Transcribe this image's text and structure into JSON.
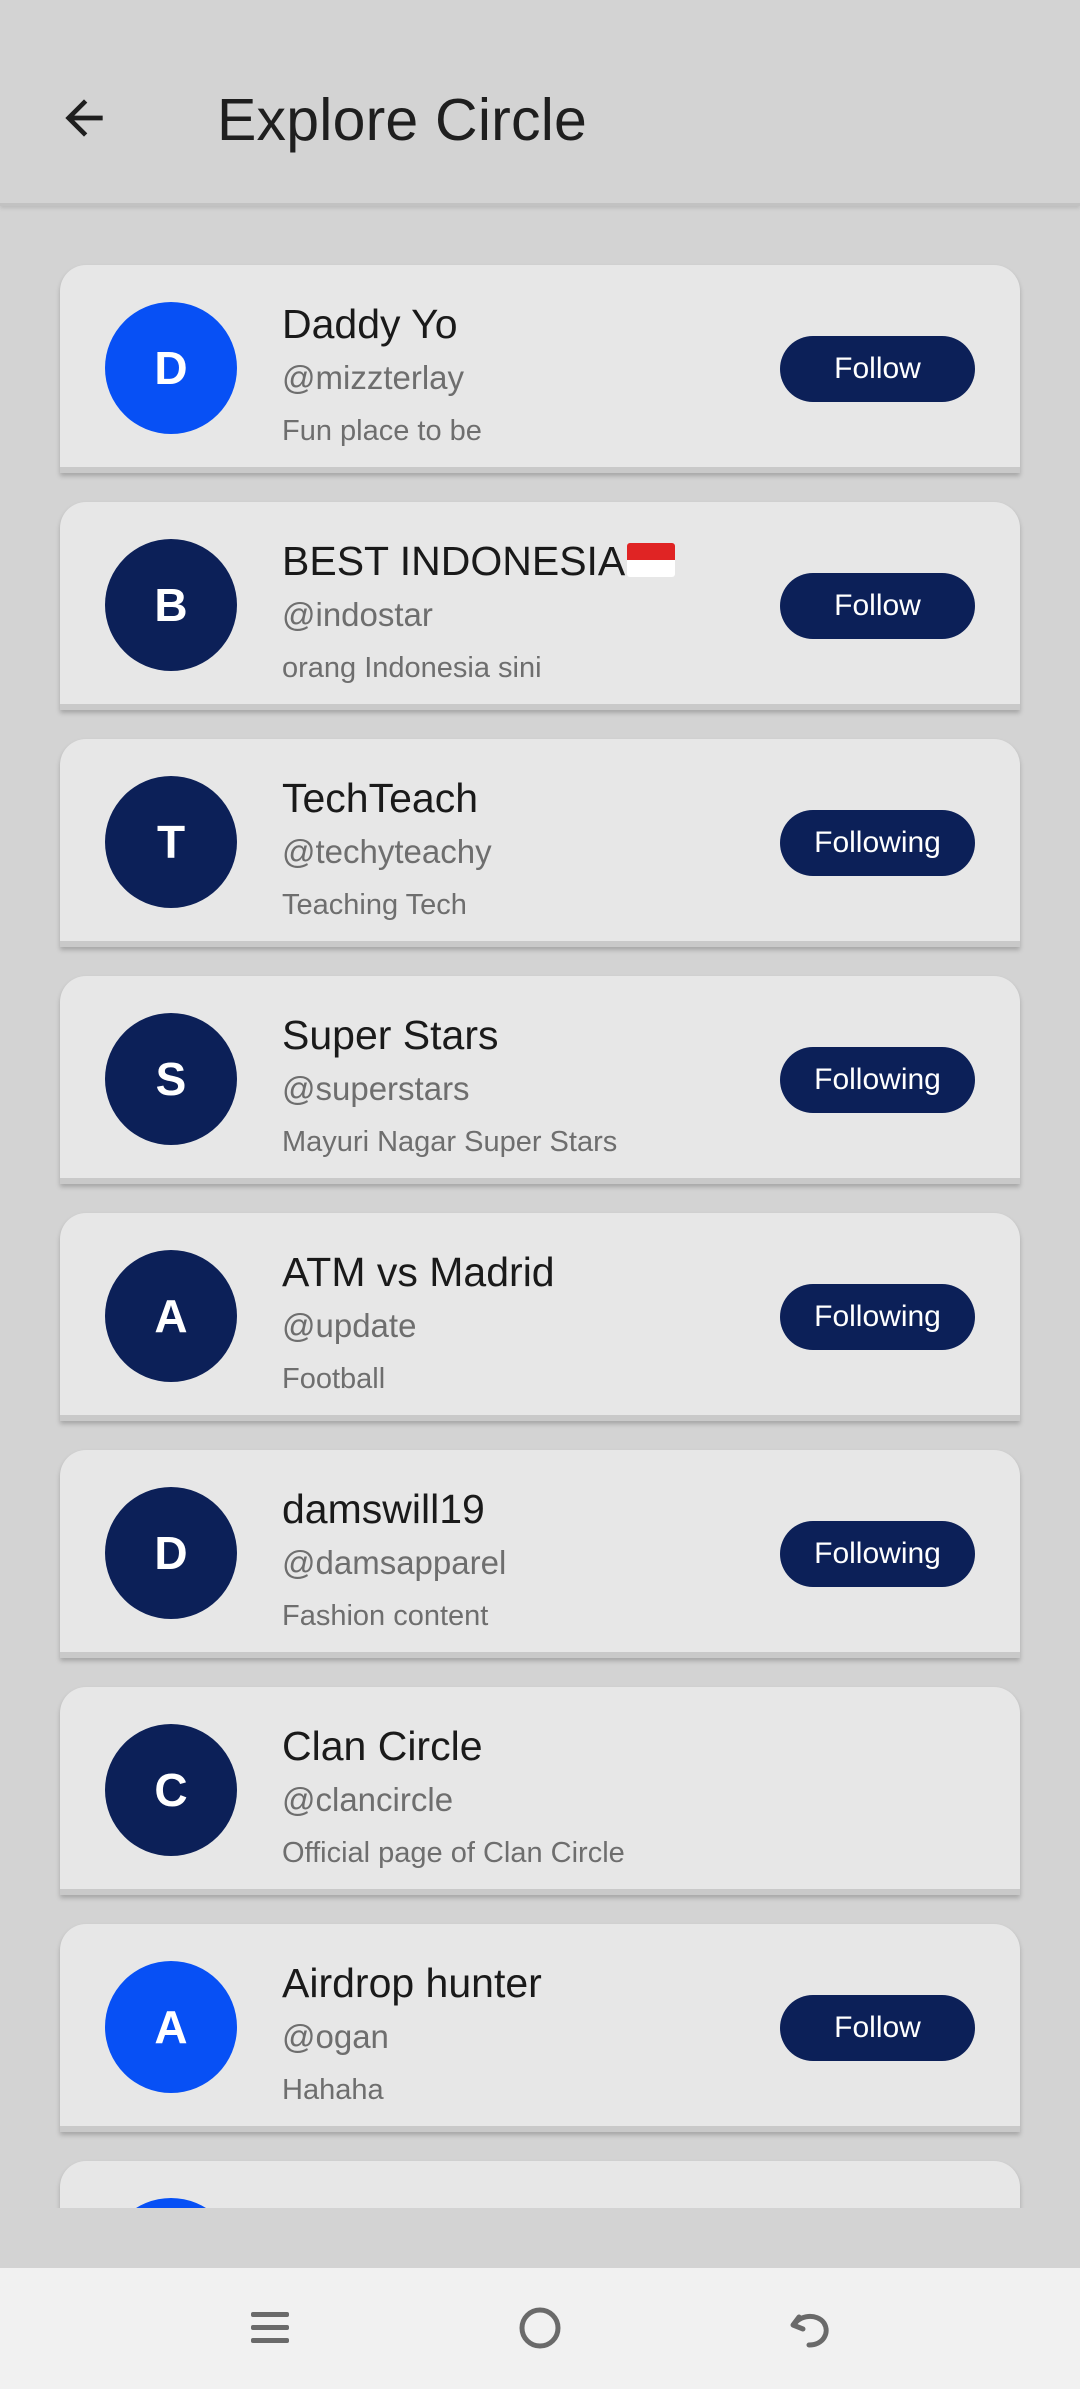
{
  "header": {
    "title": "Explore Circle"
  },
  "items": [
    {
      "initial": "D",
      "name": "Daddy Yo",
      "handle": "@mizzterlay",
      "bio": "Fun place to be",
      "button": "Follow",
      "avatar_color": "#0750f5"
    },
    {
      "initial": "B",
      "name": "BEST INDONESIA",
      "handle": "@indostar",
      "bio": "orang Indonesia sini",
      "button": "Follow",
      "avatar_color": "#0c2058"
    },
    {
      "initial": "T",
      "name": "TechTeach",
      "handle": "@techyteachy",
      "bio": "Teaching Tech",
      "button": "Following",
      "avatar_color": "#0c2058"
    },
    {
      "initial": "S",
      "name": "Super Stars",
      "handle": "@superstars",
      "bio": "Mayuri Nagar Super Stars",
      "button": "Following",
      "avatar_color": "#0c2058"
    },
    {
      "initial": "A",
      "name": "ATM vs Madrid",
      "handle": "@update",
      "bio": "Football",
      "button": "Following",
      "avatar_color": "#0c2058"
    },
    {
      "initial": "D",
      "name": "damswill19",
      "handle": "@damsapparel",
      "bio": "Fashion content",
      "button": "Following",
      "avatar_color": "#0c2058"
    },
    {
      "initial": "C",
      "name": "Clan Circle",
      "handle": "@clancircle",
      "bio": "Official page of Clan Circle",
      "button": "",
      "avatar_color": "#0c2058"
    },
    {
      "initial": "A",
      "name": "Airdrop hunter",
      "handle": "@ogan",
      "bio": "Hahaha",
      "button": "Follow",
      "avatar_color": "#0750f5"
    },
    {
      "initial": "",
      "name": "",
      "handle": "",
      "bio": "",
      "button": "",
      "avatar_color": "#0750f5"
    }
  ],
  "colors": {
    "primary": "#0c2058",
    "accent_blue": "#0750f5",
    "background": "#d3d3d3",
    "card": "#e7e7e7"
  },
  "icons": {
    "back": "arrow-left-icon",
    "nav_menu": "menu-icon",
    "nav_home": "home-circle-icon",
    "nav_back": "undo-back-icon"
  }
}
